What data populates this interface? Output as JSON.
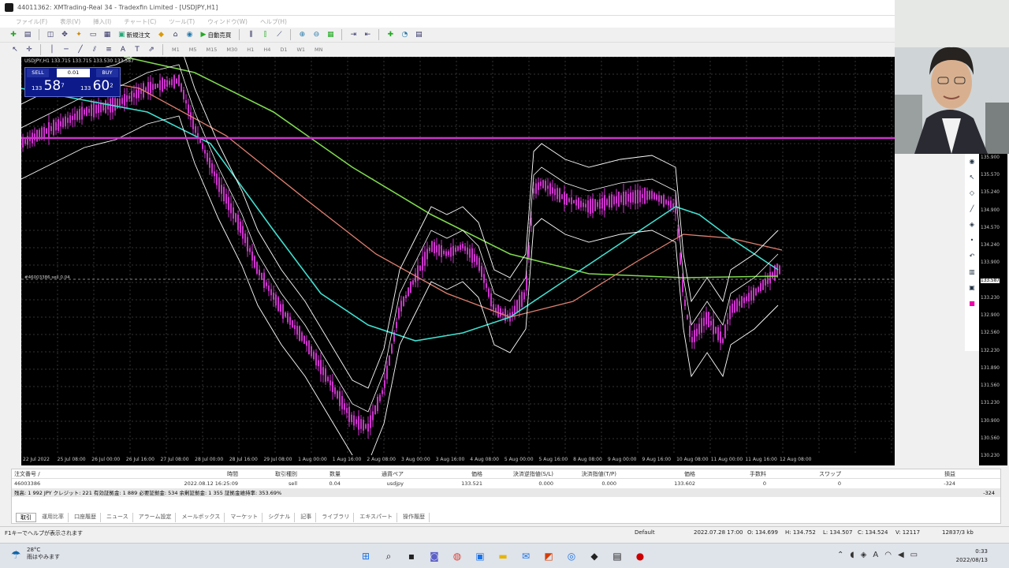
{
  "window": {
    "title": "44011362: XMTrading-Real 34 - Tradexfin Limited - [USDJPY,H1]"
  },
  "menu": [
    "ファイル(F)",
    "表示(V)",
    "挿入(I)",
    "チャート(C)",
    "ツール(T)",
    "ウィンドウ(W)",
    "ヘルプ(H)"
  ],
  "toolbar": {
    "new_order": "新規注文",
    "auto_trade": "自動売買"
  },
  "timeframes": [
    "M1",
    "M5",
    "M15",
    "M30",
    "H1",
    "H4",
    "D1",
    "W1",
    "MN"
  ],
  "chart": {
    "symbol_label": "USDJPY,H1  133.715 133.715 133.530 133.587",
    "one_click": {
      "sell": "SELL",
      "buy": "BUY",
      "lot": "0.01",
      "bid_prefix": "133",
      "bid_big": "58",
      "bid_sup": "7",
      "ask_prefix": "133",
      "ask_big": "60",
      "ask_sup": "2"
    },
    "order_line_label": "#46003386 sell 0.04",
    "price_labels": [
      "135.900",
      "135.570",
      "135.240",
      "134.900",
      "134.570",
      "134.240",
      "133.900",
      "133.587",
      "133.230",
      "132.900",
      "132.560",
      "132.230",
      "131.890",
      "131.560",
      "131.230",
      "130.900",
      "130.560",
      "130.230"
    ],
    "time_labels": [
      "22 Jul 2022",
      "25 Jul 08:00",
      "26 Jul 00:00",
      "26 Jul 16:00",
      "27 Jul 08:00",
      "28 Jul 00:00",
      "28 Jul 16:00",
      "29 Jul 08:00",
      "1 Aug 00:00",
      "1 Aug 16:00",
      "2 Aug 08:00",
      "3 Aug 00:00",
      "3 Aug 16:00",
      "4 Aug 08:00",
      "5 Aug 00:00",
      "5 Aug 16:00",
      "8 Aug 08:00",
      "9 Aug 00:00",
      "9 Aug 16:00",
      "10 Aug 08:00",
      "11 Aug 00:00",
      "11 Aug 16:00",
      "12 Aug 08:00"
    ],
    "colors": {
      "bg": "#000000",
      "candle": "#cc33cc",
      "ma_green": "#7fd94f",
      "ma_salmon": "#e08070",
      "ma_cyan": "#40e0d0",
      "bands": "#ffffff",
      "hline": "#cc33cc"
    }
  },
  "terminal": {
    "headers": [
      "注文番号 /",
      "時間",
      "取引種別",
      "数量",
      "通貨ペア",
      "価格",
      "決済逆指値(S/L)",
      "決済指値(T/P)",
      "価格",
      "手数料",
      "スワップ",
      "損益"
    ],
    "row": [
      "46003386",
      "2022.08.12 16:25:09",
      "sell",
      "0.04",
      "usdjpy",
      "133.521",
      "0.000",
      "0.000",
      "133.602",
      "0",
      "0",
      "-324"
    ],
    "balance": "残高: 1 992 JPY  クレジット: 221  有効証拠金: 1 889  必要証拠金: 534  余剰証拠金: 1 355  証拠金維持率: 353.69%",
    "balance_pl": "-324",
    "tabs": [
      "取引",
      "運用比率",
      "口座履歴",
      "ニュース",
      "アラーム設定",
      "メールボックス",
      "マーケット",
      "シグナル",
      "記事",
      "ライブラリ",
      "エキスパート",
      "操作履歴"
    ]
  },
  "statusbar": {
    "help": "F1キーでヘルプが表示されます",
    "profile": "Default",
    "time": "2022.07.28 17:00",
    "open": "O: 134.699",
    "high": "H: 134.752",
    "low": "L: 134.507",
    "close": "C: 134.524",
    "volume": "V: 12117",
    "traffic": "12837/3 kb"
  },
  "taskbar": {
    "temp": "28°C",
    "weather": "雨はやみます",
    "time": "0:33",
    "date": "2022/08/13"
  }
}
